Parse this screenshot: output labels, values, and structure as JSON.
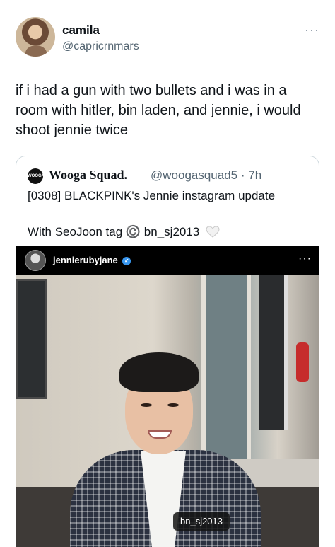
{
  "tweet": {
    "author": {
      "display_name": "camila",
      "handle": "@capricrnmars"
    },
    "more_label": "···",
    "text": "if i had a gun with two bullets and i was in a room with hitler, bin laden, and jennie, i would shoot jennie twice"
  },
  "quote": {
    "logo_text": "WOOGA",
    "author": {
      "display_name": "Wooga Squad.",
      "handle_time": "@woogasquad5 · 7h"
    },
    "line1": "[0308] BLACKPINK's Jennie instagram update",
    "line2": "With SeoJoon tag ©️ bn_sj2013",
    "instagram": {
      "username": "jennierubyjane",
      "verified_mark": "✓",
      "more_label": "···",
      "photo_tag": "bn_sj2013"
    }
  },
  "icons": {
    "heart": "white-heart-icon",
    "verified": "verified-badge-icon",
    "more": "more-dots-icon"
  },
  "colors": {
    "text": "#0f1419",
    "secondary_text": "#536471",
    "border": "#cfd9de",
    "ig_bar": "#000000",
    "verified_blue": "#3897f0"
  }
}
